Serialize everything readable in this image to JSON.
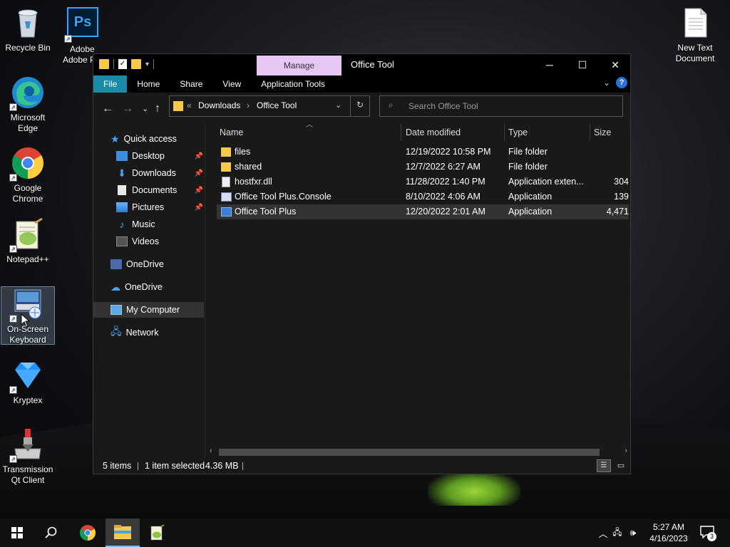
{
  "desktop": {
    "icons": [
      {
        "label": "Recycle Bin",
        "icon": "recycle-bin-icon"
      },
      {
        "label": "Adobe Photosh",
        "icon": "photoshop-icon"
      },
      {
        "label": "New Text Document",
        "icon": "text-document-icon"
      },
      {
        "label": "Microsoft Edge",
        "icon": "edge-icon"
      },
      {
        "label": "Google Chrome",
        "icon": "chrome-icon"
      },
      {
        "label": "Notepad++",
        "icon": "notepadpp-icon"
      },
      {
        "label": "On-Screen Keyboard",
        "icon": "keyboard-icon"
      },
      {
        "label": "Kryptex",
        "icon": "kryptex-icon"
      },
      {
        "label": "Transmission Qt Client",
        "icon": "transmission-icon"
      }
    ]
  },
  "explorer": {
    "title": "Office Tool",
    "manage_tab": "Manage",
    "ribbon_tabs": [
      "File",
      "Home",
      "Share",
      "View",
      "Application Tools"
    ],
    "address": {
      "prefix": "«",
      "crumbs": [
        "Downloads",
        "Office Tool"
      ]
    },
    "search_placeholder": "Search Office Tool",
    "nav": [
      {
        "label": "Quick access"
      },
      {
        "label": "Desktop",
        "pinned": true
      },
      {
        "label": "Downloads",
        "pinned": true
      },
      {
        "label": "Documents",
        "pinned": true
      },
      {
        "label": "Pictures",
        "pinned": true
      },
      {
        "label": "Music"
      },
      {
        "label": "Videos"
      },
      {
        "label": "OneDrive"
      },
      {
        "label": "OneDrive"
      },
      {
        "label": "My Computer"
      },
      {
        "label": "Network"
      }
    ],
    "columns": [
      "Name",
      "Date modified",
      "Type",
      "Size"
    ],
    "files": [
      {
        "name": "files",
        "date": "12/19/2022 10:58 PM",
        "type": "File folder",
        "size": "",
        "icon": "folder-icon"
      },
      {
        "name": "shared",
        "date": "12/7/2022 6:27 AM",
        "type": "File folder",
        "size": "",
        "icon": "folder-icon"
      },
      {
        "name": "hostfxr.dll",
        "date": "11/28/2022 1:40 PM",
        "type": "Application exten...",
        "size": "304",
        "icon": "dll-icon"
      },
      {
        "name": "Office Tool Plus.Console",
        "date": "8/10/2022 4:06 AM",
        "type": "Application",
        "size": "139",
        "icon": "app-icon"
      },
      {
        "name": "Office Tool Plus",
        "date": "12/20/2022 2:01 AM",
        "type": "Application",
        "size": "4,471",
        "icon": "app-icon"
      }
    ],
    "status": {
      "items": "5 items",
      "selected": "1 item selected",
      "size": "4.36 MB"
    }
  },
  "taskbar": {
    "time": "5:27 AM",
    "date": "4/16/2023",
    "notifications": "3"
  },
  "colors": {
    "accent": "#1a8ca7",
    "manage": "#e7c8f5",
    "folder": "#f5c94c"
  }
}
